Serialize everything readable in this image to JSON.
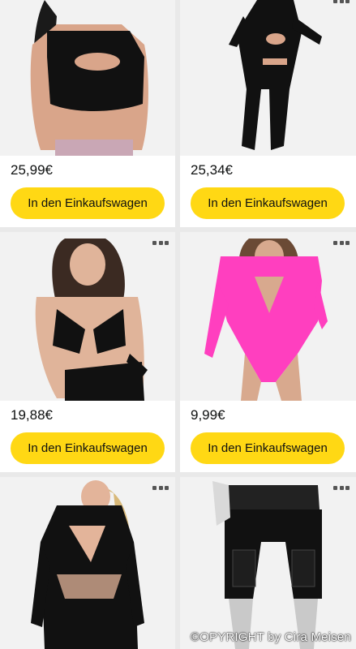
{
  "products": [
    {
      "price": "25,99€",
      "button_label": "In den Einkaufswagen",
      "image": "black cutout crop top"
    },
    {
      "price": "25,34€",
      "button_label": "In den Einkaufswagen",
      "image": "black cutout jumpsuit"
    },
    {
      "price": "19,88€",
      "button_label": "In den Einkaufswagen",
      "image": "black strappy bikini top"
    },
    {
      "price": "9,99€",
      "button_label": "In den Einkaufswagen",
      "image": "pink long sleeve bodysuit"
    },
    {
      "price": "",
      "button_label": "",
      "image": "black mesh cutout bodysuit"
    },
    {
      "price": "",
      "button_label": "",
      "image": "black cargo shorts"
    }
  ],
  "watermark": "©OPYRIGHT by Cira Meisen",
  "colors": {
    "button": "#ffd814",
    "page_bg": "#e9e9e9",
    "card_bg": "#ffffff"
  }
}
